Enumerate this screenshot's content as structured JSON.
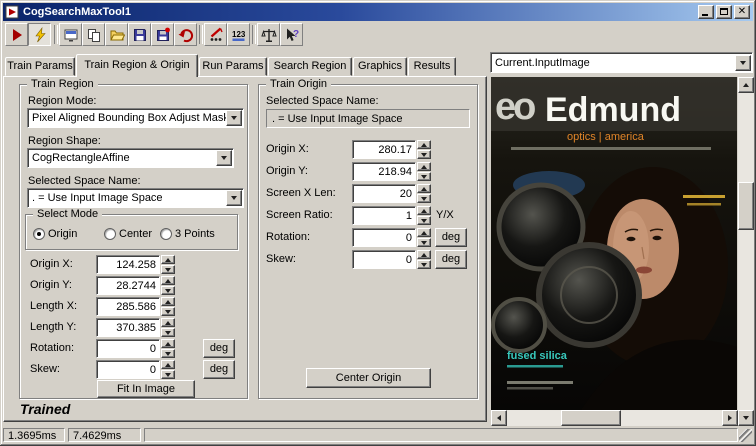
{
  "window": {
    "title": "CogSearchMaxTool1"
  },
  "toolbar": {
    "numeric_label": "123",
    "icons": [
      "run-icon",
      "electrode-icon",
      "image-display-icon",
      "copy-icon",
      "open-icon",
      "save-icon",
      "save-image-icon",
      "undo-icon",
      "probe-icon",
      "numeric-icon",
      "balance-icon",
      "help-pointer-icon"
    ]
  },
  "tabs": {
    "items": [
      "Train Params",
      "Train Region & Origin",
      "Run Params",
      "Search Region",
      "Graphics",
      "Results"
    ],
    "active": "Train Region & Origin"
  },
  "image_panel": {
    "selector_value": "Current.InputImage",
    "cover": {
      "logo": "eo",
      "brand": "Edmund",
      "subtitle": "optics  |  america",
      "highlight": "fused silica"
    }
  },
  "train_region": {
    "legend": "Train Region",
    "region_mode_label": "Region Mode:",
    "region_mode_value": "Pixel Aligned Bounding Box Adjust Mask",
    "region_shape_label": "Region Shape:",
    "region_shape_value": "CogRectangleAffine",
    "space_label": "Selected Space Name:",
    "space_value": ". = Use Input Image Space",
    "select_mode": {
      "legend": "Select Mode",
      "options": [
        "Origin",
        "Center",
        "3 Points"
      ],
      "selected": "Origin"
    },
    "fields": [
      {
        "label": "Origin X:",
        "value": "124.258"
      },
      {
        "label": "Origin Y:",
        "value": "28.2744"
      },
      {
        "label": "Length X:",
        "value": "285.586"
      },
      {
        "label": "Length Y:",
        "value": "370.385"
      },
      {
        "label": "Rotation:",
        "value": "0",
        "unit": "deg"
      },
      {
        "label": "Skew:",
        "value": "0",
        "unit": "deg"
      }
    ],
    "fit_button": "Fit In Image"
  },
  "train_origin": {
    "legend": "Train Origin",
    "space_label": "Selected Space Name:",
    "space_value": ". = Use Input Image Space",
    "fields": [
      {
        "label": "Origin X:",
        "value": "280.17"
      },
      {
        "label": "Origin Y:",
        "value": "218.94"
      },
      {
        "label": "Screen X Len:",
        "value": "20"
      },
      {
        "label": "Screen Ratio:",
        "value": "1",
        "unit": "Y/X"
      },
      {
        "label": "Rotation:",
        "value": "0",
        "unit": "deg"
      },
      {
        "label": "Skew:",
        "value": "0",
        "unit": "deg"
      }
    ],
    "center_button": "Center Origin"
  },
  "status": {
    "trained": "Trained",
    "time1": "1.3695ms",
    "time2": "7.4629ms"
  }
}
